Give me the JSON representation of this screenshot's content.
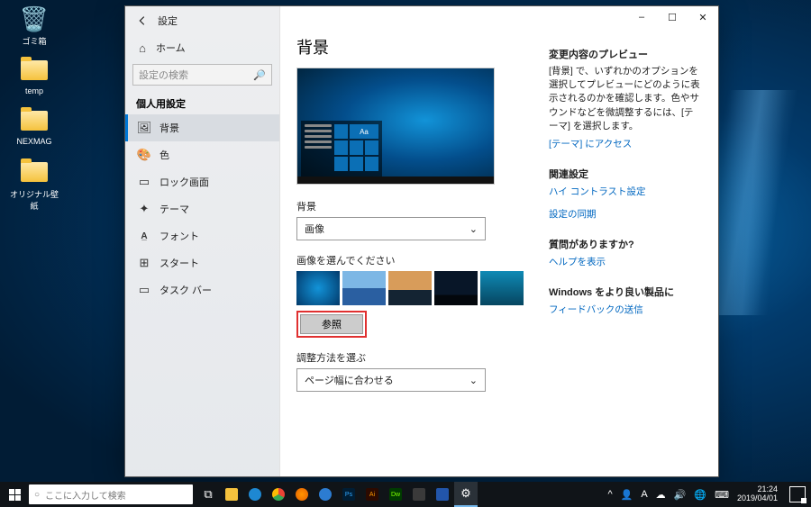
{
  "desktop": {
    "trash": "ゴミ箱",
    "temp": "temp",
    "nexmag": "NEXMAG",
    "wallpaper": "オリジナル壁紙"
  },
  "window": {
    "app_name": "設定",
    "home": "ホーム",
    "search_placeholder": "設定の検索",
    "category": "個人用設定",
    "nav": {
      "background": "背景",
      "colors": "色",
      "lockscreen": "ロック画面",
      "themes": "テーマ",
      "fonts": "フォント",
      "start": "スタート",
      "taskbar": "タスク バー"
    },
    "btn_min": "–",
    "btn_max": "☐",
    "btn_close": "✕"
  },
  "main": {
    "title": "背景",
    "bg_label": "背景",
    "bg_value": "画像",
    "choose_label": "画像を選んでください",
    "browse": "参照",
    "fit_label": "調整方法を選ぶ",
    "fit_value": "ページ幅に合わせる",
    "preview_tile": "Aa"
  },
  "side": {
    "preview_heading": "変更内容のプレビュー",
    "preview_body": "[背景] で、いずれかのオプションを選択してプレビューにどのように表示されるのかを確認します。色やサウンドなどを微調整するには、[テーマ] を選択します。",
    "theme_link": "[テーマ] にアクセス",
    "related_heading": "関連設定",
    "high_contrast": "ハイ コントラスト設定",
    "sync": "設定の同期",
    "question_heading": "質問がありますか?",
    "help": "ヘルプを表示",
    "improve_heading": "Windows をより良い製品に",
    "feedback": "フィードバックの送信"
  },
  "taskbar": {
    "search_placeholder": "ここに入力して検索",
    "time": "21:24",
    "date": "2019/04/01",
    "tray_up": "^"
  }
}
